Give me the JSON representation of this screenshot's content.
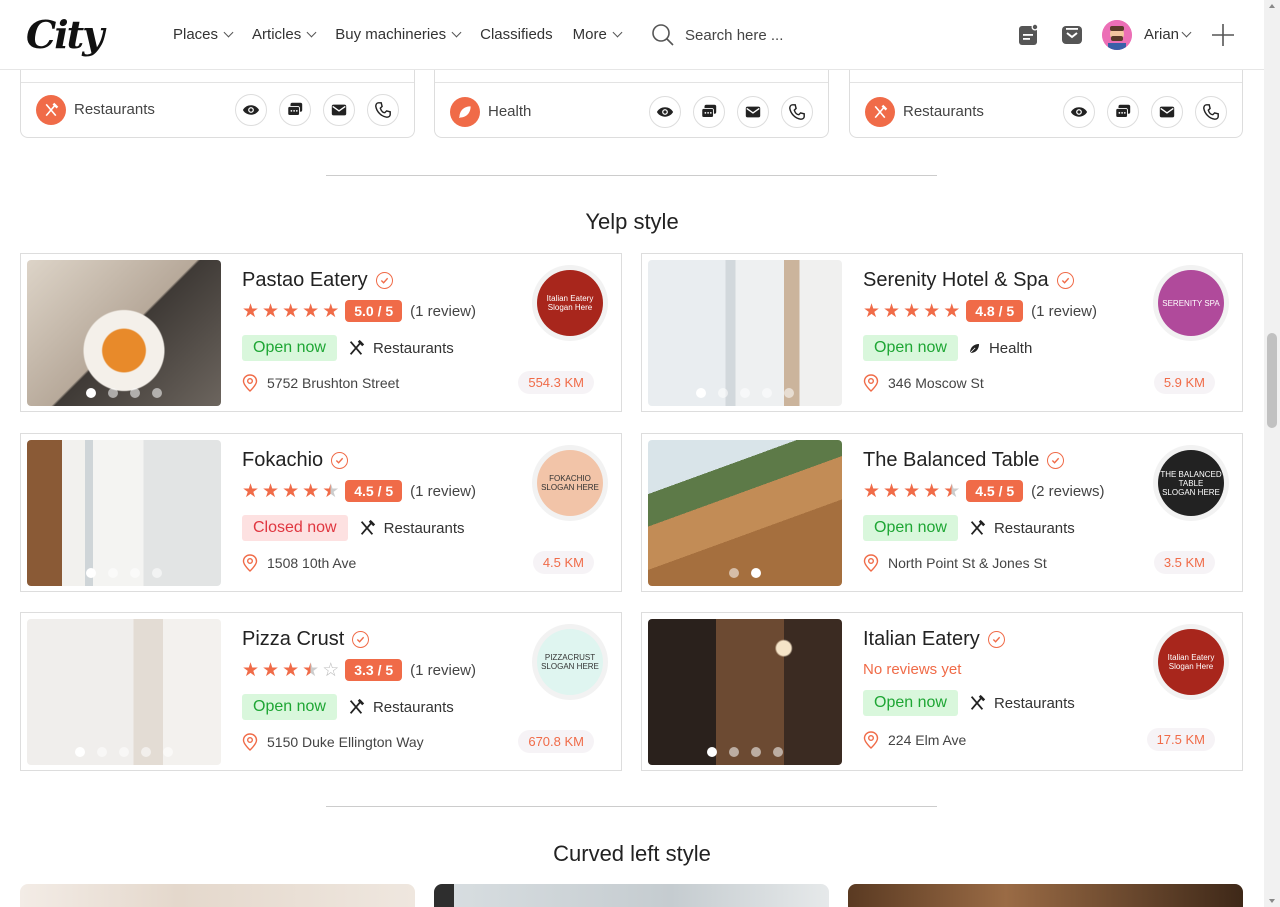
{
  "header": {
    "logo": "City",
    "nav": [
      "Places",
      "Articles",
      "Buy machineries",
      "Classifieds",
      "More"
    ],
    "nav_dropdown": [
      true,
      true,
      true,
      false,
      true
    ],
    "search_placeholder": "Search here ...",
    "username": "Arian"
  },
  "top_cards": [
    {
      "category": "Restaurants",
      "icon": "utensils-icon"
    },
    {
      "category": "Health",
      "icon": "leaf-icon"
    },
    {
      "category": "Restaurants",
      "icon": "utensils-icon"
    }
  ],
  "sections": {
    "yelp": "Yelp style",
    "curved": "Curved left style"
  },
  "listings": [
    {
      "name": "Pastao Eatery",
      "stars": 5,
      "score": "5.0 / 5",
      "reviews": "(1 review)",
      "status": "Open now",
      "open": true,
      "category": "Restaurants",
      "cat_icon": "utensils-icon",
      "address": "5752 Brushton Street",
      "distance": "554.3 KM",
      "dots": 4,
      "active_dot": 0,
      "logo": {
        "lines": [
          "Italian Eatery",
          "Slogan Here"
        ],
        "bg": "#a8261c"
      }
    },
    {
      "name": "Serenity Hotel & Spa",
      "stars": 5,
      "score": "4.8 / 5",
      "reviews": "(1 review)",
      "status": "Open now",
      "open": true,
      "category": "Health",
      "cat_icon": "leaf-icon",
      "address": "346 Moscow St",
      "distance": "5.9 KM",
      "dots": 5,
      "active_dot": 0,
      "logo": {
        "lines": [
          "SERENITY SPA"
        ],
        "bg": "#b04a9b"
      }
    },
    {
      "name": "Fokachio",
      "stars": 4.5,
      "score": "4.5 / 5",
      "reviews": "(1 review)",
      "status": "Closed now",
      "open": false,
      "category": "Restaurants",
      "cat_icon": "utensils-icon",
      "address": "1508 10th Ave",
      "distance": "4.5 KM",
      "dots": 4,
      "active_dot": 0,
      "logo": {
        "lines": [
          "FOKACHIO",
          "SLOGAN HERE"
        ],
        "bg": "#f2c4a8"
      }
    },
    {
      "name": "The Balanced Table",
      "stars": 4.5,
      "score": "4.5 / 5",
      "reviews": "(2 reviews)",
      "status": "Open now",
      "open": true,
      "category": "Restaurants",
      "cat_icon": "utensils-icon",
      "address": "North Point St & Jones St",
      "distance": "3.5 KM",
      "dots": 2,
      "active_dot": 1,
      "logo": {
        "lines": [
          "THE BALANCED TABLE",
          "SLOGAN HERE"
        ],
        "bg": "#222222"
      }
    },
    {
      "name": "Pizza Crust",
      "stars": 3.5,
      "score": "3.3 / 5",
      "reviews": "(1 review)",
      "status": "Open now",
      "open": true,
      "category": "Restaurants",
      "cat_icon": "utensils-icon",
      "address": "5150 Duke Ellington Way",
      "distance": "670.8 KM",
      "dots": 5,
      "active_dot": 0,
      "logo": {
        "lines": [
          "PIZZACRUST",
          "SLOGAN HERE"
        ],
        "bg": "#dff5f0"
      }
    },
    {
      "name": "Italian Eatery",
      "stars": 0,
      "score": "",
      "reviews": "",
      "no_reviews": "No reviews yet",
      "status": "Open now",
      "open": true,
      "category": "Restaurants",
      "cat_icon": "utensils-icon",
      "address": "224 Elm Ave",
      "distance": "17.5 KM",
      "dots": 4,
      "active_dot": 0,
      "logo": {
        "lines": [
          "Italian Eatery",
          "Slogan Here"
        ],
        "bg": "#a8261c"
      }
    }
  ],
  "colors": {
    "accent": "#f06b48",
    "open_bg": "#d9f7dc",
    "open_fg": "#1ea634",
    "closed_bg": "#fde1e1",
    "closed_fg": "#e0363f"
  }
}
